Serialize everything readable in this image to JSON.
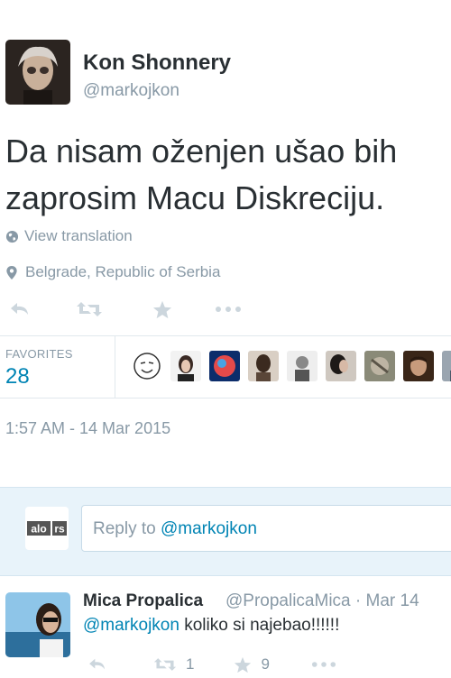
{
  "author": {
    "name": "Kon Shonnery",
    "handle": "@markojkon"
  },
  "tweet": {
    "text_line1": "Da nisam oženjen ušao bih",
    "text_line2": "zaprosim Macu Diskreciju."
  },
  "meta": {
    "view_translation": "View translation",
    "location": "Belgrade, Republic of Serbia",
    "timestamp": "1:57 AM - 14 Mar 2015"
  },
  "stats": {
    "favorites_label": "FAVORITES",
    "favorites_count": "28"
  },
  "reply_box": {
    "logo_text": "alo rs",
    "prefix": "Reply to",
    "mention": "@markojkon"
  },
  "reply_tweet": {
    "name": "Mica Propalica",
    "handle_date": "@PropalicaMica · Mar 14",
    "mention": "@markojkon",
    "text": "koliko si najebao!!!!!!",
    "retweet_count": "1",
    "favorite_count": "9"
  },
  "colors": {
    "link": "#0084b4",
    "muted": "#8899a6",
    "icon": "#ccd6dd",
    "reply_bg": "#e8f3fa"
  }
}
